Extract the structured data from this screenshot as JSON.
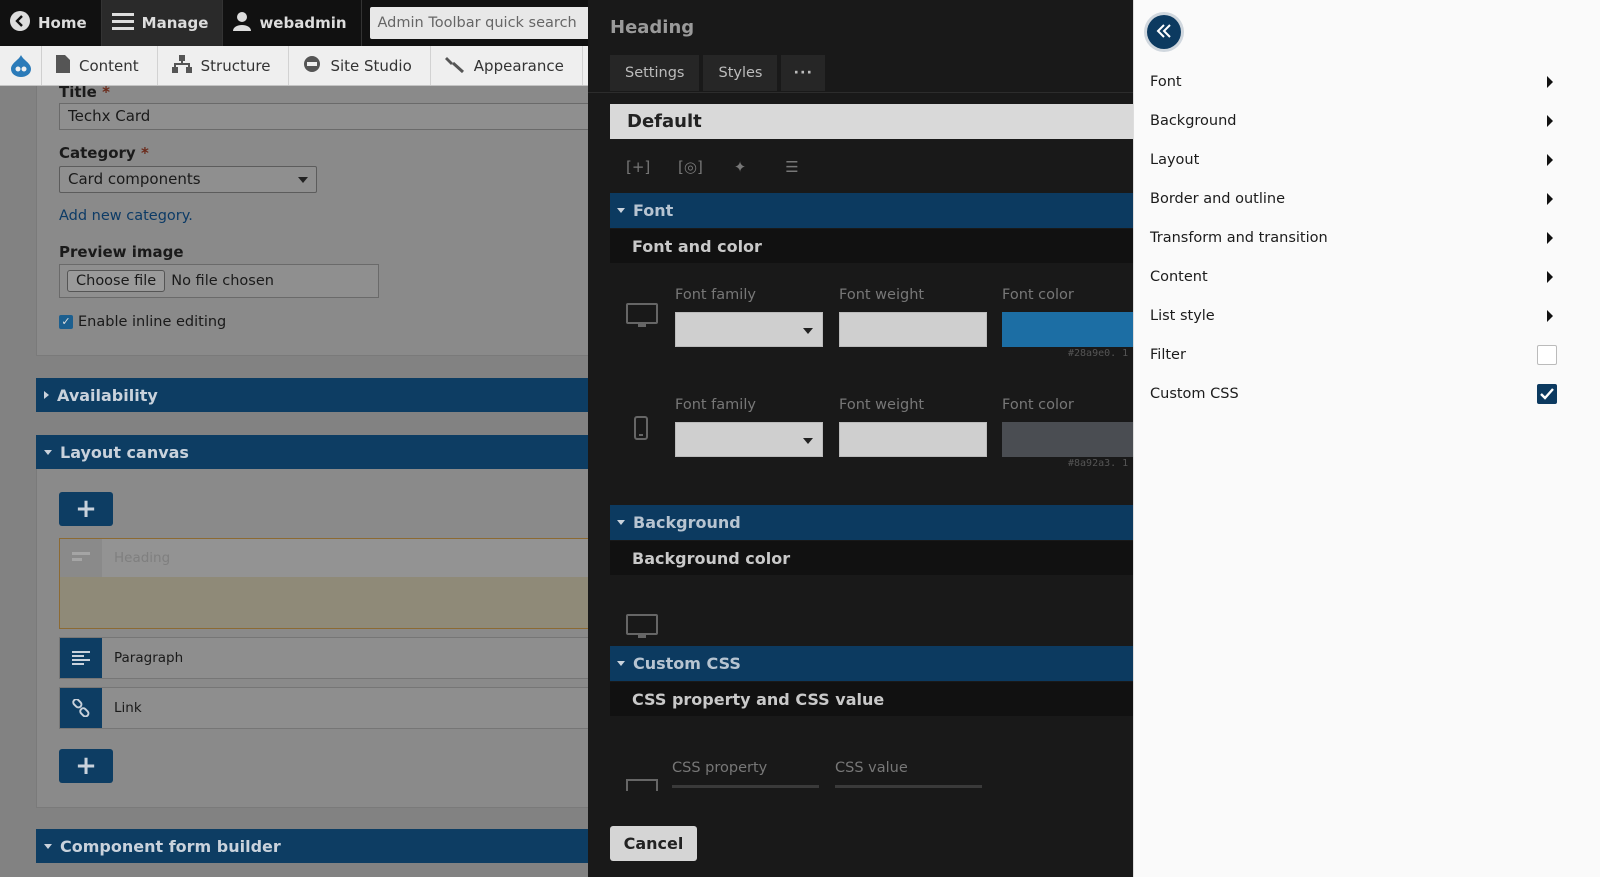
{
  "toolbar": {
    "home_label": "Home",
    "manage_label": "Manage",
    "user_label": "webadmin",
    "search_placeholder": "Admin Toolbar quick search",
    "tray": [
      "Content",
      "Structure",
      "Site Studio",
      "Appearance"
    ]
  },
  "form": {
    "title_label": "Title",
    "required_mark": "*",
    "title_value": "Techx Card",
    "category_label": "Category",
    "category_value": "Card components",
    "add_category_link": "Add new category.",
    "preview_label": "Preview image",
    "choose_file_label": "Choose file",
    "no_file_text": "No file chosen",
    "inline_editing_label": "Enable inline editing",
    "inline_editing_checked": true,
    "sections": {
      "availability": "Availability",
      "layout_canvas": "Layout canvas",
      "component_form_builder": "Component form builder"
    },
    "canvas_items": [
      "Heading",
      "Paragraph",
      "Link"
    ]
  },
  "modal": {
    "title": "Heading",
    "tabs": [
      "Settings",
      "Styles",
      "···"
    ],
    "style_name": "Default",
    "font_section": "Font",
    "font_subsection": "Font and color",
    "desktop": {
      "font_family_label": "Font family",
      "font_weight_label": "Font weight",
      "font_color_label": "Font color",
      "color_value": "#28a9e0. 1",
      "color_hex": "#1c6ea4"
    },
    "mobile": {
      "font_family_label": "Font family",
      "font_weight_label": "Font weight",
      "font_color_label": "Font color",
      "color_value": "#8a92a3. 1",
      "color_hex": "#4a4d52"
    },
    "background_section": "Background",
    "background_subsection": "Background color",
    "css_section": "Custom CSS",
    "css_subsection": "CSS property and CSS value",
    "css_property_label": "CSS property",
    "css_value_label": "CSS value",
    "cancel_label": "Cancel"
  },
  "panel": {
    "items": [
      {
        "label": "Font",
        "control": "arrow"
      },
      {
        "label": "Background",
        "control": "arrow"
      },
      {
        "label": "Layout",
        "control": "arrow"
      },
      {
        "label": "Border and outline",
        "control": "arrow"
      },
      {
        "label": "Transform and transition",
        "control": "arrow"
      },
      {
        "label": "Content",
        "control": "arrow"
      },
      {
        "label": "List style",
        "control": "arrow"
      },
      {
        "label": "Filter",
        "control": "checkbox",
        "checked": false
      },
      {
        "label": "Custom CSS",
        "control": "checkbox",
        "checked": true
      }
    ]
  },
  "colors": {
    "accent": "#0c3a60",
    "modal_bg": "#191919",
    "panel_bg": "#fafafa"
  }
}
